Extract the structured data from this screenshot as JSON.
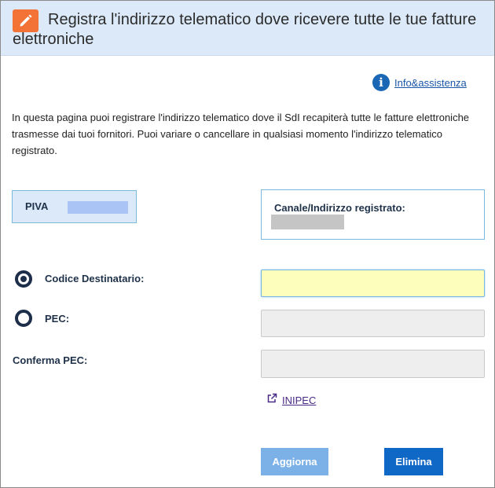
{
  "header": {
    "title": "Registra l'indirizzo telematico dove ricevere tutte le tue fatture elettroniche",
    "icon": "pencil-icon",
    "icon_color": "#f37336",
    "background": "#dbe9f9"
  },
  "help": {
    "icon": "info-icon",
    "label": "Info&assistenza"
  },
  "intro": {
    "text": "In questa pagina puoi registrare l'indirizzo telematico dove il SdI recapiterà tutte le fatture elettroniche trasmesse dai tuoi fornitori. Puoi variare o cancellare in qualsiasi momento l'indirizzo telematico registrato."
  },
  "piva": {
    "label": "PIVA",
    "value": ""
  },
  "canale": {
    "label": "Canale/Indirizzo registrato:",
    "value": ""
  },
  "form": {
    "codice_destinatario": {
      "label": "Codice Destinatario:",
      "selected": true,
      "value": ""
    },
    "pec": {
      "label": "PEC:",
      "selected": false,
      "value": ""
    },
    "conferma_pec": {
      "label": "Conferma PEC:",
      "value": ""
    }
  },
  "inipec": {
    "icon": "external-link-icon",
    "label": "INIPEC"
  },
  "actions": {
    "aggiorna_label": "Aggiorna",
    "elimina_label": "Elimina"
  },
  "colors": {
    "accent": "#0f67c6",
    "disabled_button": "#7cb1e8",
    "active_input": "#fdfdbc",
    "radio": "#1d2e4a"
  }
}
